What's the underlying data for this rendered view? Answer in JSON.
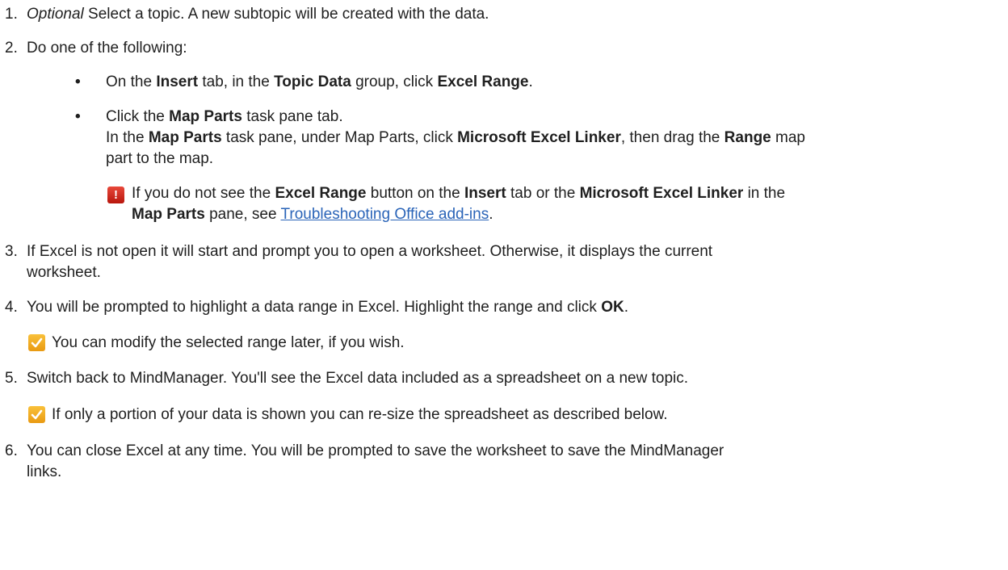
{
  "steps": [
    {
      "num": "1.",
      "optional": "Optional",
      "text": " Select a topic. A new subtopic will be created with the data."
    },
    {
      "num": "2.",
      "text": "Do one of the following:"
    },
    {
      "num": "3.",
      "line1": "If Excel is not open it will start and prompt you to open a worksheet. Otherwise, it displays the current",
      "line2": "worksheet."
    },
    {
      "num": "4.",
      "t1": "You will be prompted to highlight a data range in Excel. Highlight the range and click ",
      "b1": "OK",
      "t2": "."
    },
    {
      "num": "5.",
      "text": "Switch back to MindManager. You'll see the Excel data included as a spreadsheet on a new topic."
    },
    {
      "num": "6.",
      "line1": "You can close Excel at any time. You will be prompted to save the worksheet to save the MindManager",
      "line2": "links."
    }
  ],
  "bullets": [
    {
      "t1": "On the ",
      "b1": "Insert",
      "t2": " tab, in the ",
      "b2": "Topic Data",
      "t3": " group, click ",
      "b3": "Excel Range",
      "t4": "."
    },
    {
      "line1_t1": "Click the ",
      "line1_b1": "Map Parts",
      "line1_t2": " task pane tab.",
      "line2_t1": "In the ",
      "line2_b1": "Map Parts",
      "line2_t2": " task pane, under Map Parts, click ",
      "line2_b2": "Microsoft Excel Linker",
      "line2_t3": ", then drag the ",
      "line2_b3": "Range",
      "line2_t4": " map",
      "line3": "part to the map."
    }
  ],
  "warning": {
    "icon": "!",
    "t1": "If you do not see the ",
    "b1": "Excel Range",
    "t2": " button on the ",
    "b2": "Insert",
    "t3": " tab or the ",
    "b3": "Microsoft Excel Linker",
    "t4": " in the",
    "b4": "Map Parts",
    "t5": " pane, see ",
    "link": "Troubleshooting Office add-ins",
    "t6": "."
  },
  "tips": [
    {
      "text": "You can modify the selected range later, if you wish."
    },
    {
      "text": "If only a portion of your data is shown you can re-size the spreadsheet as described below."
    }
  ],
  "colors": {
    "warning_icon": "#c9211a",
    "tip_icon": "#f2ad22",
    "link": "#2a64b8"
  }
}
